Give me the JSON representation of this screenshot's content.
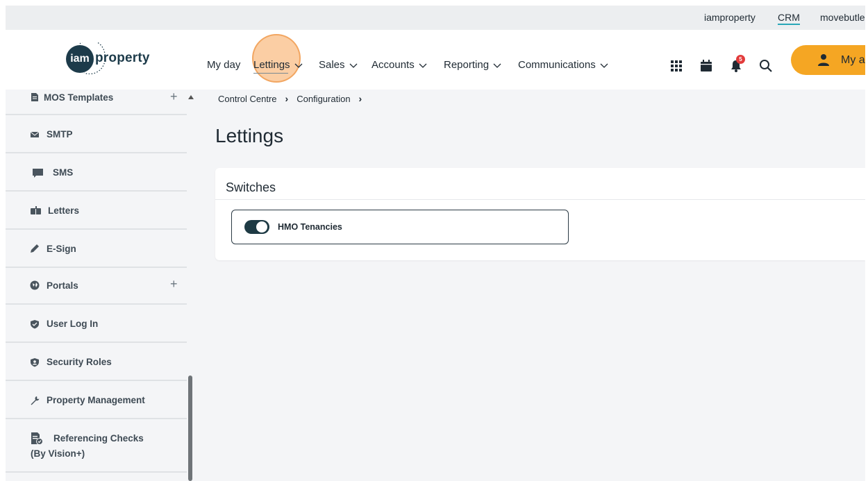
{
  "topbar": {
    "links": [
      "iamproperty",
      "CRM",
      "movebutle"
    ]
  },
  "logo": {
    "circle_text": "iam",
    "wordmark": "property"
  },
  "nav": {
    "items": [
      "My day",
      "Lettings",
      "Sales",
      "Accounts",
      "Reporting",
      "Communications"
    ]
  },
  "notifications": {
    "count": "5"
  },
  "account": {
    "label": "My ac"
  },
  "sidebar": {
    "items": [
      {
        "label": "MOS Templates"
      },
      {
        "label": "SMTP"
      },
      {
        "label": "SMS"
      },
      {
        "label": "Letters"
      },
      {
        "label": "E-Sign"
      },
      {
        "label": "Portals"
      },
      {
        "label": "User Log In"
      },
      {
        "label": "Security Roles"
      },
      {
        "label": "Property Management"
      },
      {
        "label": "Referencing Checks",
        "label2": "(By Vision+)"
      }
    ]
  },
  "breadcrumb": {
    "items": [
      "Control Centre",
      "Configuration"
    ]
  },
  "page": {
    "title": "Lettings"
  },
  "card": {
    "title": "Switches",
    "switch": {
      "label": "HMO Tenancies",
      "state": "on"
    }
  },
  "colors": {
    "accent": "#f5a623",
    "brand": "#1d3b4a",
    "link_underline": "#2aa7b8",
    "badge": "#e23b3b"
  }
}
